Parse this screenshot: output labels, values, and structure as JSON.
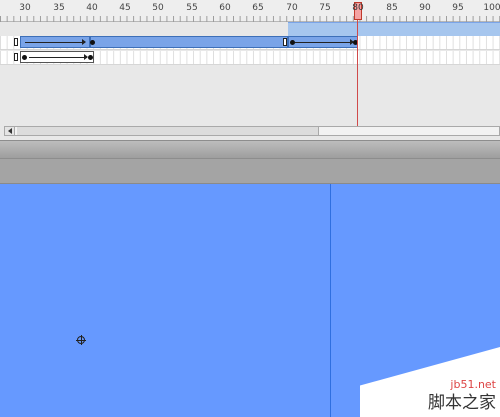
{
  "timeline": {
    "ruler_labels": [
      "30",
      "35",
      "40",
      "45",
      "50",
      "55",
      "60",
      "65",
      "70",
      "75",
      "80",
      "85",
      "90",
      "95",
      "100"
    ],
    "current_frame": "80"
  },
  "colors": {
    "stage_background": "#6699ff",
    "tween_span": "#a9c8f0",
    "playhead": "#d04a4a"
  },
  "icons": {
    "keyframe": "keyframe-dot-icon",
    "blank_keyframe": "blank-keyframe-icon",
    "registration": "registration-point-icon",
    "scroll_left": "scroll-left-arrow-icon"
  },
  "watermark": {
    "site": "jb51.net",
    "cn": "脚本之家"
  }
}
